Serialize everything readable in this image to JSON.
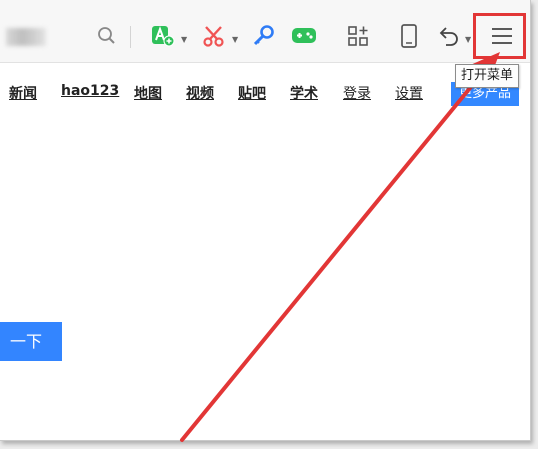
{
  "toolbar": {
    "tooltip": "打开菜单",
    "icons": [
      "search-icon",
      "translate-icon",
      "screenshot-scissors-icon",
      "zoom-key-icon",
      "game-icon",
      "apps-icon",
      "mobile-icon",
      "undo-icon",
      "menu-icon"
    ]
  },
  "nav": {
    "items": [
      "新闻",
      "hao123",
      "地图",
      "视频",
      "贴吧",
      "学术",
      "登录",
      "设置"
    ],
    "more_button": "更多产品"
  },
  "search": {
    "button_label": "一下"
  },
  "colors": {
    "accent": "#3388ff",
    "annotation": "#e23636",
    "green": "#2fc05a",
    "red": "#f05454",
    "blue": "#2f7cf6"
  }
}
